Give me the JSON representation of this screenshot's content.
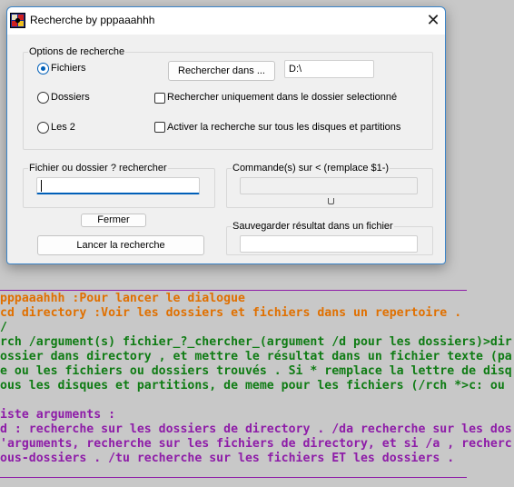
{
  "window": {
    "title": "Recherche by pppaaahhh",
    "close_glyph": "✕"
  },
  "options": {
    "group_label": "Options de recherche",
    "radio_files": "Fichiers",
    "radio_folders": "Dossiers",
    "radio_both": "Les 2",
    "browse_button": "Rechercher dans ...",
    "path_value": "D:\\",
    "check_only_selected": "Rechercher uniquement dans le dossier selectionné",
    "check_all_disks": "Activer la recherche sur tous les disques et partitions",
    "selected_radio": "files"
  },
  "search": {
    "group_label": "Fichier ou dossier ? rechercher",
    "input_value": ""
  },
  "commands": {
    "group_label": "Commande(s) sur < (remplace $1-)",
    "input_value": ""
  },
  "buttons": {
    "close_label": "Fermer",
    "launch_label": "Lancer la recherche"
  },
  "save": {
    "group_label": "Sauvegarder résultat dans un fichier",
    "input_value": ""
  },
  "console": {
    "lines": [
      {
        "text": "pppaaahhh :Pour lancer le dialogue",
        "color": "#e07000"
      },
      {
        "text": "cd directory :Voir les dossiers et fichiers dans un repertoire .",
        "color": "#e07000"
      },
      {
        "text": "/",
        "color": "#0f7c14"
      },
      {
        "text": "rch /argument(s) fichier_?_chercher_(argument /d pour les dossiers)>dir",
        "color": "#0f7c14"
      },
      {
        "text": "ossier dans directory , et mettre le résultat dans un fichier texte (pa",
        "color": "#0f7c14"
      },
      {
        "text": "e ou les fichiers ou dossiers trouvés . Si * remplace la lettre de disq",
        "color": "#0f7c14"
      },
      {
        "text": "ous les disques et partitions, de meme pour les fichiers (/rch *>c: ou",
        "color": "#0f7c14"
      },
      {
        "text": "iste arguments :",
        "color": "#8e1ca8"
      },
      {
        "text": "d : recherche sur les dossiers de directory . /da recherche sur les dos",
        "color": "#8e1ca8"
      },
      {
        "text": "'arguments, recherche sur les fichiers de directory, et si /a , recherc",
        "color": "#8e1ca8"
      },
      {
        "text": "ous-dossiers . /tu recherche sur les fichiers ET les dossiers .",
        "color": "#8e1ca8"
      }
    ]
  },
  "colors": {
    "accent": "#005fb8",
    "console_orange": "#e07000",
    "console_green": "#0f7c14",
    "console_purple": "#8e1ca8"
  }
}
